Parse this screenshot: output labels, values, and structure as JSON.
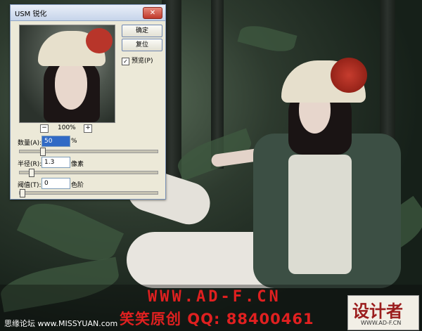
{
  "dialog": {
    "title": "USM 锐化",
    "close_icon": "close-x-icon",
    "ok_label": "确定",
    "reset_label": "复位",
    "preview_label": "预览(P)",
    "preview_checked": true,
    "zoom_percent": "100%",
    "zoom_minus": "−",
    "zoom_plus": "+",
    "amount": {
      "label": "数量(A):",
      "value": "50",
      "unit": "%",
      "slider_fraction": 0.15
    },
    "radius": {
      "label": "半径(R):",
      "value": "1.3",
      "unit": "像素",
      "slider_fraction": 0.07
    },
    "threshold": {
      "label": "阈值(T):",
      "value": "0",
      "unit": "色阶",
      "slider_fraction": 0.0
    }
  },
  "watermark": {
    "url": "WWW.AD-F.CN",
    "line2": "笑笑原创 QQ: 88400461",
    "forum": "思缘论坛 www.MISSYUAN.com",
    "logo_text": "设计者",
    "logo_url": "WWW.AD-F.CN"
  },
  "colors": {
    "watermark_red": "#e02020",
    "dialog_bg": "#ece9d8",
    "jacket": "#3c4f44"
  }
}
